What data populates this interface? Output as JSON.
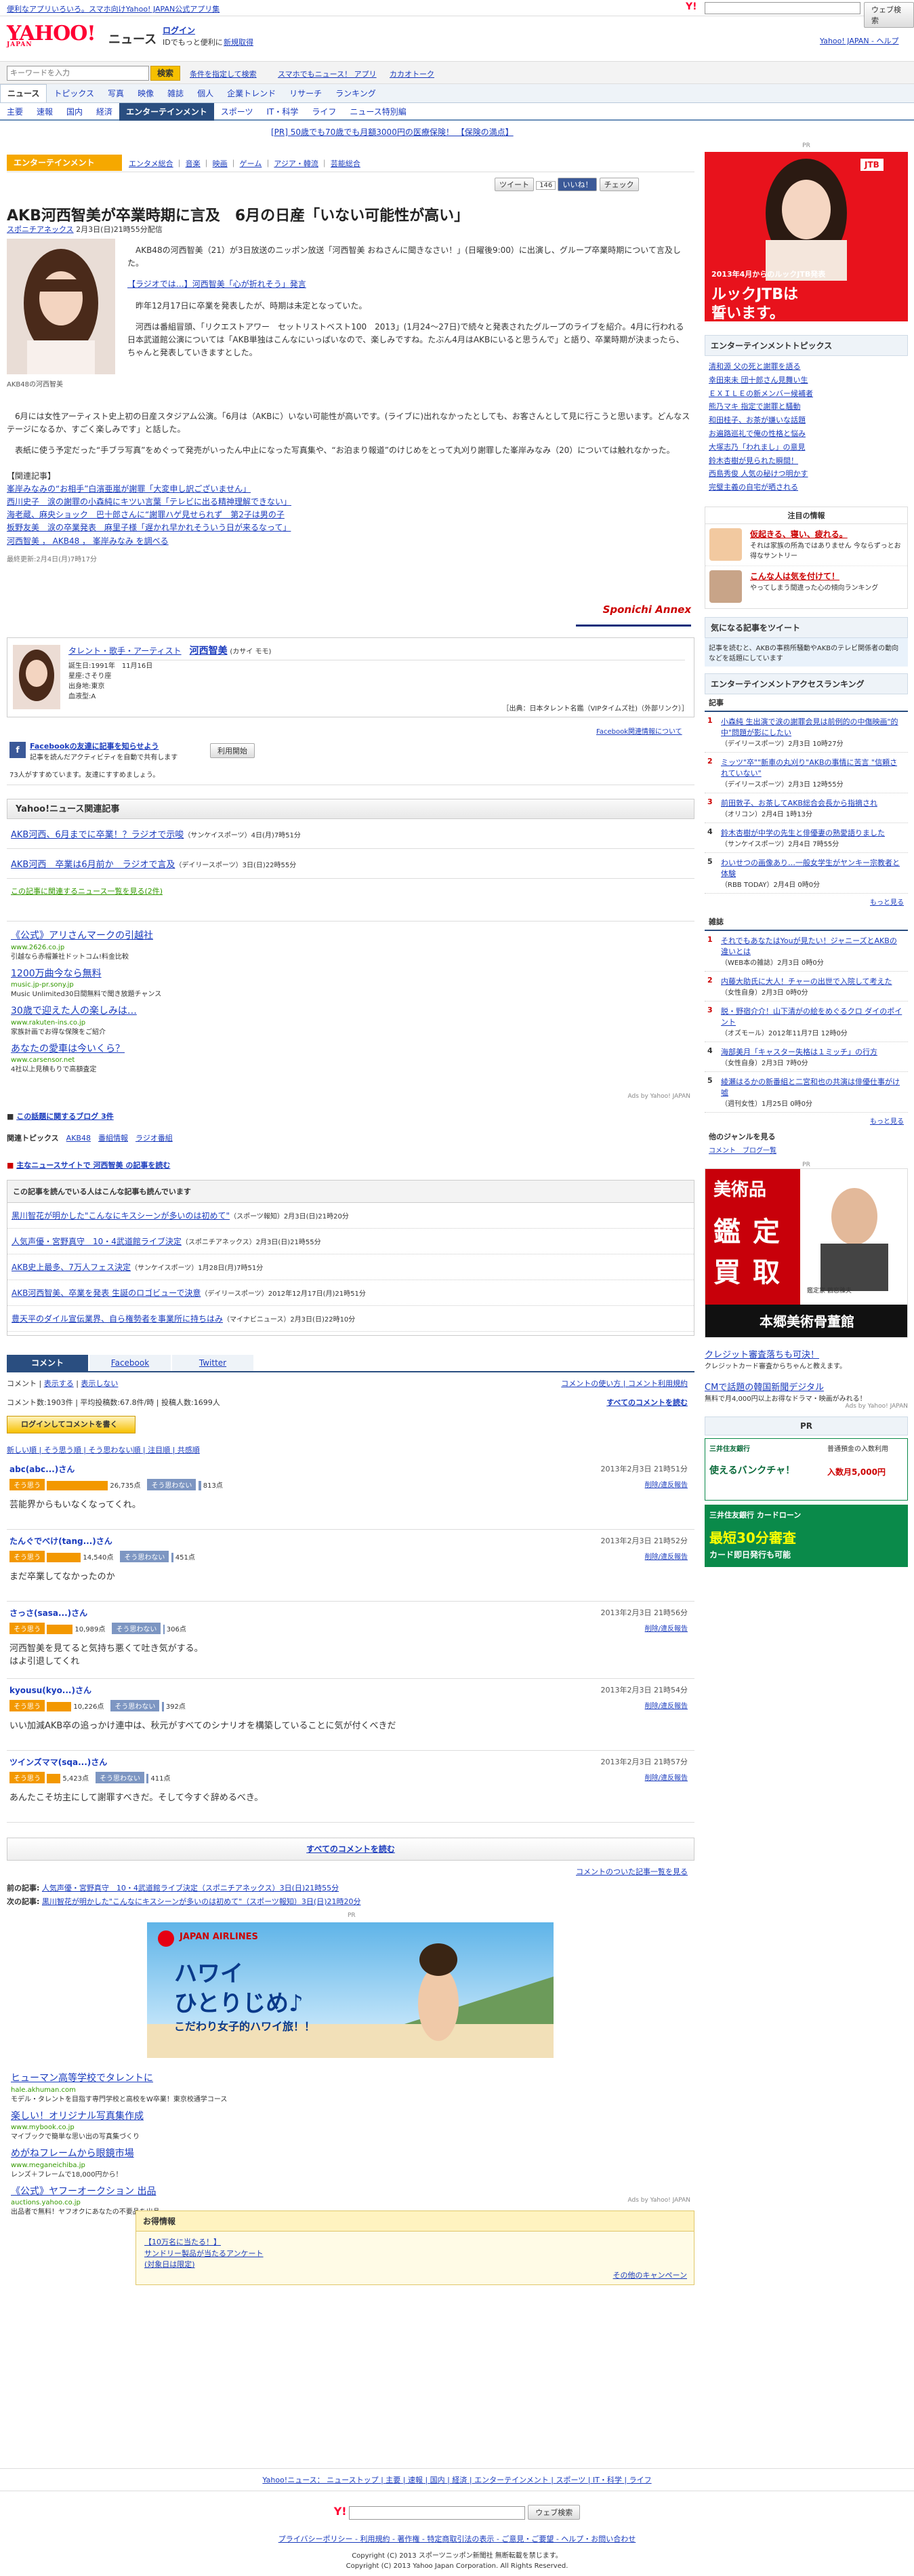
{
  "topbar": {
    "left_links": [
      "便利なアプリいろいろ。スマホ向けYahoo! JAPAN公式アプリ集"
    ],
    "search_btn": "ウェブ検索",
    "right": "Yahoo! JAPAN"
  },
  "header": {
    "logo": "YAHOO!",
    "logo_sub": "JAPAN",
    "service": "ニュース",
    "login": "ログイン",
    "login_sub": "IDでもっと便利に",
    "signup": "新規取得",
    "right_links": "Yahoo! JAPAN - ヘルプ"
  },
  "search": {
    "placeholder": "キーワードを入力",
    "button": "検索",
    "links": [
      "条件を指定して検索",
      "スマホでもニュース！ アプリ",
      "カカオトーク"
    ]
  },
  "nav1": [
    "ニュース",
    "トピックス",
    "写真",
    "映像",
    "雑誌",
    "個人",
    "企業トレンド",
    "リサーチ",
    "ランキング"
  ],
  "nav2": [
    "主要",
    "速報",
    "国内",
    "経済",
    "エンターテインメント",
    "スポーツ",
    "IT・科学",
    "ライフ",
    "ニュース特別編"
  ],
  "ad_text": "[PR] 50歳でも70歳でも月額3000円の医療保険！ 【保険の満点】",
  "catbar": {
    "tag": "エンターテインメント",
    "links": [
      "エンタメ総合",
      "音楽",
      "映画",
      "ゲーム",
      "アジア・韓流",
      "芸能総合"
    ]
  },
  "share": {
    "tweet": "ツイート",
    "tweet_count": "146",
    "like": "いいね！",
    "check": "チェック"
  },
  "article": {
    "title": "AKB河西智美が卒業時期に言及　6月の日産「いない可能性が高い」",
    "source": "スポニチアネックス",
    "date": "2月3日(日)21時55分配信",
    "photo_caption": "AKB48の河西智美",
    "p1": "　AKB48の河西智美（21）が3日放送のニッポン放送「河西智美 おねさんに聞きなさい！」(日曜後9:00）に出演し、グループ卒業時期について言及した。",
    "radio_link": "【ラジオでは…】河西智美「心が折れそう」発言",
    "p2": "　昨年12月17日に卒業を発表したが、時期は未定となっていた。",
    "p3": "　河西は番組冒頭、「リクエストアワー　セットリストベスト100　2013」(1月24〜27日)で続々と発表されたグループのライブを紹介。4月に行われる日本武道館公演については「AKB単独はこんなにいっぱいなので、楽しみですね。たぶん4月はAKBにいると思うんで」と語り、卒業時期が決まったら、ちゃんと発表していきますとした。",
    "p4": "　6月には女性アーティスト史上初の日産スタジアム公演。「6月は（AKBに）いない可能性が高いです。(ライブに)出れなかったとしても、お客さんとして見に行こうと思います。どんなステージになるか、すごく楽しみです」と話した。",
    "p5": "　表紙に使う予定だった“手ブラ写真”をめぐって発売がいったん中止になった写真集や、“お泊まり報道”のけじめをとって丸刈り謝罪した峯岸みなみ（20）については触れなかった。",
    "related_head": "【関連記事】",
    "related": [
      "峯岸みなみの“お相手”白濱亜嵐が謝罪「大変申し訳ございません」",
      "西川史子　涙の謝罪の小森純にキツい言葉「テレビに出る精神理解できない」",
      "海老蔵、麻央ショック　巴十郎さんに“謝罪ハゲ見せられず　第2子は男の子",
      "板野友美　涙の卒業発表　麻里子様「遅かれ早かれそういう日が来るなって」",
      "河西智美 ， AKB48 ， 峯岸みなみ を調べる"
    ],
    "updated": "最終更新:2月4日(月)7時17分",
    "logo": "Sponichi Annex"
  },
  "talent": {
    "label": "タレント・歌手・アーティスト",
    "name": "河西智美",
    "kana": "(カサイ モモ)",
    "born": "誕生日:1991年　11月16日",
    "blood": "星座:さそり座",
    "place": "出身地:東京",
    "type": "血液型:A",
    "source": "［出典：日本タレント名鑑（VIPタイムズ社)（外部リンク）］"
  },
  "facebook": {
    "title": "Facebookの友達に記事を知らせよう",
    "desc": "記事を読んだアクティビティを自動で共有します",
    "btn": "利用開始",
    "note": "73人がすすめています。友達にすすめましょう。",
    "related_link": "Facebook関連情報について"
  },
  "related_section": {
    "head": "Yahoo!ニュース関連記事",
    "items": [
      {
        "t": "AKB河西、6月までに卒業！？ラジオで示唆",
        "s": "（サンケイスポーツ）4日(月)7時51分"
      },
      {
        "t": "AKB河西　卒業は6月前か　ラジオで言及",
        "s": "（デイリースポーツ）3日(日)22時55分"
      }
    ],
    "more": "この記事に関連するニュース一覧を見る(2件)"
  },
  "ads1": [
    {
      "t": "《公式》アリさんマークの引越社",
      "u": "www.2626.co.jp",
      "d": "引越なら赤帽兼社ドットコム!料金比較"
    },
    {
      "t": "1200万曲今なら無料",
      "u": "music.jp-pr.sony.jp",
      "d": "Music Unlimited30日間無料で聞き放題チャンス"
    },
    {
      "t": "30歳で迎えた人の楽しみは…",
      "u": "www.rakuten-ins.co.jp",
      "d": "家族計画でお得な保険をご紹介"
    },
    {
      "t": "あなたの愛車は今いくら？",
      "u": "www.carsensor.net",
      "d": "4社以上見積もりで高額査定"
    }
  ],
  "ads1_credit": "Ads by Yahoo! JAPAN",
  "blog_line": "この話題に関するブログ 3件",
  "topics": {
    "label": "関連トピックス",
    "items": [
      "AKB48",
      "番組情報",
      "ラジオ番組"
    ]
  },
  "mainsite": "主なニュースサイトで 河西智美 の記事を読む",
  "also_read": {
    "head": "この記事を読んでいる人はこんな記事も読んでいます",
    "items": [
      {
        "t": "黒川智花が明かした\"こんなにキスシーンが多いのは初めて\"",
        "s": "（スポーツ報知）2月3日(日)21時20分"
      },
      {
        "t": "人気声優・宮野真守　10・4武道館ライブ決定",
        "s": "（スポニチアネックス）2月3日(日)21時55分"
      },
      {
        "t": "AKB史上最多、7万人フェス決定",
        "s": "（サンケイスポーツ）1月28日(月)7時51分"
      },
      {
        "t": "AKB河西智美、卒業を発表 生誕のロゴビューで決意",
        "s": "（デイリースポーツ）2012年12月17日(月)21時51分"
      },
      {
        "t": "豊天平のダイル宣伝業界、自ら権勢者を事業所に持ちはみ",
        "s": "（マイナビニュース）2月3日(日)22時10分"
      }
    ]
  },
  "comment_tabs": [
    "コメント",
    "Facebook",
    "Twitter"
  ],
  "comment_controls": {
    "sort": "コメント",
    "show": "表示する",
    "hide": "表示しない",
    "read_all": "すべてのコメントを読む",
    "about": "コメントの使い方",
    "about2": "コメント利用規約"
  },
  "comment_stats": {
    "count": "コメント数:1903件",
    "avg": "平均投稿数:67.8件/時",
    "users": "投稿人数:1699人"
  },
  "comment_login": "ログインしてコメントを書く",
  "comment_sort": "新しい順 | そう思う順 | そう思わない順 | 注目順 | 共感順",
  "comments": [
    {
      "name": "abc(abc...)さん",
      "date": "2013年2月3日 21時51分",
      "up": "26,735点",
      "down": "813点",
      "text": "芸能界からもいなくなってくれ。"
    },
    {
      "name": "たんぐでべけ(tang...)さん",
      "date": "2013年2月3日 21時52分",
      "up": "14,540点",
      "down": "451点",
      "text": "まだ卒業してなかったのか"
    },
    {
      "name": "さっさ(sasa...)さん",
      "date": "2013年2月3日 21時56分",
      "up": "10,989点",
      "down": "306点",
      "text": "河西智美を見てると気持ち悪くて吐き気がする。\nはよ引退してくれ"
    },
    {
      "name": "kyousu(kyo...)さん",
      "date": "2013年2月3日 21時54分",
      "up": "10,226点",
      "down": "392点",
      "text": "いい加減AKB卒の追っかけ連中は、秋元がすべてのシナリオを構築していることに気が付くべきだ"
    },
    {
      "name": "ツインズママ(sqa...)さん",
      "date": "2013年2月3日 21時57分",
      "up": "5,423点",
      "down": "411点",
      "text": "あんたこそ坊主にして謝罪すべきだ。そして今すぐ辞めるべき。"
    }
  ],
  "comment_actions": "削除/違反報告",
  "all_comments": "すべてのコメントを読む",
  "comment_list_link": "コメントのついた記事一覧を見る",
  "prevnext": {
    "prev_label": "前の記事:",
    "prev": "人気声優・宮野真守　10・4武道館ライブ決定（スポニチアネックス）3日(日)21時55分",
    "next_label": "次の記事:",
    "next": "黒川智花が明かした\"こんなにキスシーンが多いのは初めて\"（スポーツ報知）3日(日)21時20分"
  },
  "jal": {
    "brand": "JAPAN AIRLINES",
    "headline1": "ハワイ",
    "headline2": "ひとりじめ♪",
    "sub": "こだわり女子的ハワイ旅！！"
  },
  "ads2": [
    {
      "t": "ヒューマン高等学校でタレントに",
      "u": "hale.akhuman.com",
      "d": "モデル・タレントを目指す専門学校と高校をW卒業！東京校通学コース"
    },
    {
      "t": "楽しい！オリジナル写真集作成",
      "u": "www.mybook.co.jp",
      "d": "マイブックで簡単な思い出の写真集づくり"
    },
    {
      "t": "めがねフレームから眼鏡市場",
      "u": "www.meganeichiba.jp",
      "d": "レンズ＋フレームで18,000円から！"
    },
    {
      "t": "《公式》ヤフーオークション 出品",
      "u": "auctions.yahoo.co.jp",
      "d": "出品者で無料！ヤフオクにあなたの不要品を出品"
    }
  ],
  "ads2_credit": "Ads by Yahoo! JAPAN",
  "otoku": {
    "head": "お得情報",
    "items": [
      "【10万名に当たる！】",
      "サンドリー製品が当たるアンケート",
      "(対象日は限定)"
    ],
    "more": "その他のキャンペーン"
  },
  "side": {
    "pr": "PR",
    "jtb": {
      "brand": "JTB",
      "l1": "2013年4月からのルックJTB発表",
      "l2": "ルックJTBは",
      "l3": "誓います。"
    },
    "ent_topics_head": "エンターテインメントトピックス",
    "ent_topics": [
      "清和源 父の死と謝罪を語る",
      "幸田來未 団十郎さん見舞い生",
      "ＥＸＩＬＥの新メンバー候補者",
      "熊乃マキ 指定で謝罪と騒動",
      "和田桂子、お茶が嫌いな話題",
      "お遍路巡礼で俺の性格と悩み",
      "大塚志乃「われまし」の意見",
      "鈴木杏樹が見られた瞬間！",
      "西島秀俊 人気の秘けつ明かす",
      "完璧主義の自宅が晒される"
    ],
    "chumoku_head": "注目の情報",
    "chumoku": [
      {
        "t": "仮起きる、寝い、疲れる。",
        "d": "それは家族の所為ではありません 今ならずっとお得なサントリー"
      },
      {
        "t": "こんな人は気を付けて！",
        "d": "やってしまう間違った心の傾向ランキング"
      }
    ],
    "tweet_head": "気になる記事をツイート",
    "tweet_desc": "記事を読むと、AKBの事務所騒動やAKBのテレビ関係者の動向などを話題にしています",
    "ranking_head": "エンターテインメントアクセスランキング",
    "ranking_label": "記事",
    "ranking": [
      {
        "t": "小森純 生出演で涙の謝罪会見は前例的の中傷映画\"的中\"問題が影にしたい",
        "s": "（デイリースポーツ）2月3日 10時27分"
      },
      {
        "t": "ミッツ\"卒\"\"新車の丸刈り\"AKBの事情に苦言 \"信頼されていない\"",
        "s": "（デイリースポーツ）2月3日 12時55分"
      },
      {
        "t": "前田敦子、お茶してAKB総合会長から指摘され",
        "s": "（オリコン）2月4日 1時13分"
      },
      {
        "t": "鈴木杏樹が中学の先生と俳優妻の熟愛語りました",
        "s": "（サンケイスポーツ）2月4日 7時55分"
      },
      {
        "t": "わいせつの画像あり…一般女学生がヤンキー宗教者と体験",
        "s": "（RBB TODAY）2月4日 0時0分"
      }
    ],
    "ranking_more": "もっと見る",
    "zasshi_label": "雑誌",
    "zasshi": [
      {
        "t": "それでもあなたはYouが見たい！ジャニーズとAKBの違いとは",
        "s": "（WEB本の雑誌）2月3日 0時0分"
      },
      {
        "t": "内藤大助氏に大人！チャーの出世で入院して考えた",
        "s": "（女性自身）2月3日 0時0分"
      },
      {
        "t": "脱・野宿介介！山下清がの絵をめぐるクロ ダイのポイント",
        "s": "（オズモール）2012年11月7日 12時0分"
      },
      {
        "t": "海部美月「キャスター失格は１ミッチ」の行方",
        "s": "（女性自身）2月3日 7時0分"
      },
      {
        "t": "綾瀬はるかの新番組と二宮和也の共演は俳優仕事がけ嘘",
        "s": "（週刊女性）1月25日 0時0分"
      }
    ],
    "zasshi_more": "もっと見る",
    "other_head": "他のジャンルを見る",
    "other_links": "コメント　ブログ一覧",
    "art_ad": {
      "l1": "美術品",
      "l2": "鑑",
      "l3": "定",
      "l4": "買",
      "l5": "取",
      "name": "鑑定家 鶴窓雅夫",
      "foot": "本郷美術骨董館"
    },
    "sideads": [
      {
        "t": "クレジット審査落ちも可決！",
        "d": "クレジットカード審査からちゃんと教えます。"
      },
      {
        "t": "CMで話題の韓国新聞デジタル",
        "d": "無料で月4,000円以上お得なドラマ・映画がみれる！"
      }
    ],
    "sideads_credit": "Ads by Yahoo! JAPAN",
    "bank1": {
      "l1": "三井住友銀行",
      "l2": "使えるバンクチャ！",
      "l3": "普通預金の入数利用",
      "l4": "入数月5,000円"
    },
    "bank2": {
      "l1": "三井住友銀行 カードローン",
      "l2": "最短30分審査",
      "l3": "カード即日発行も可能"
    }
  },
  "footer": {
    "links": "Yahoo!ニュース： ニューストップ | 主要 | 速報 | 国内 | 経済 | エンターテインメント | スポーツ | IT・科学 | ライフ",
    "search_btn": "ウェブ検索",
    "bottom_links": "プライバシーポリシー - 利用規約 - 著作権 - 特定商取引法の表示 - ご意見・ご要望 - ヘルプ・お問い合わせ",
    "copy1": "Copyright (C) 2013 スポーツニッポン新聞社 無断転載を禁じます。",
    "copy2": "Copyright (C) 2013 Yahoo Japan Corporation. All Rights Reserved."
  },
  "colors": {
    "accent": "#ff0033",
    "link": "#1a3bbd",
    "tag": "#f6a800",
    "navy": "#2a4e80"
  }
}
